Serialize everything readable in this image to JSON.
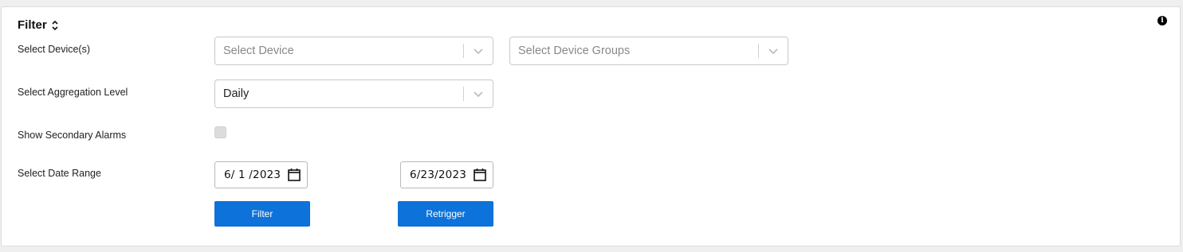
{
  "panel": {
    "title": "Filter",
    "collapse_icon": "collapse-icon",
    "info_icon": "info-icon",
    "info_glyph": "i"
  },
  "device_row": {
    "label": "Select Device(s)",
    "device_select": {
      "placeholder": "Select Device",
      "icon": "chevron-down-icon"
    },
    "group_select": {
      "placeholder": "Select Device Groups",
      "icon": "chevron-down-icon"
    }
  },
  "aggregation_row": {
    "label": "Select Aggregation Level",
    "select": {
      "value": "Daily",
      "icon": "chevron-down-icon"
    }
  },
  "alarms_row": {
    "label": "Show Secondary Alarms",
    "checked": false
  },
  "date_row": {
    "label": "Select Date Range",
    "start_date": {
      "value": "6/ 1 /2023",
      "icon": "calendar-icon"
    },
    "end_date": {
      "value": "6/23/2023",
      "icon": "calendar-icon"
    }
  },
  "actions": {
    "filter_label": "Filter",
    "retrigger_label": "Retrigger"
  },
  "colors": {
    "primary_button": "#0d72d9",
    "panel_background": "#ffffff",
    "page_background": "#efefef"
  }
}
